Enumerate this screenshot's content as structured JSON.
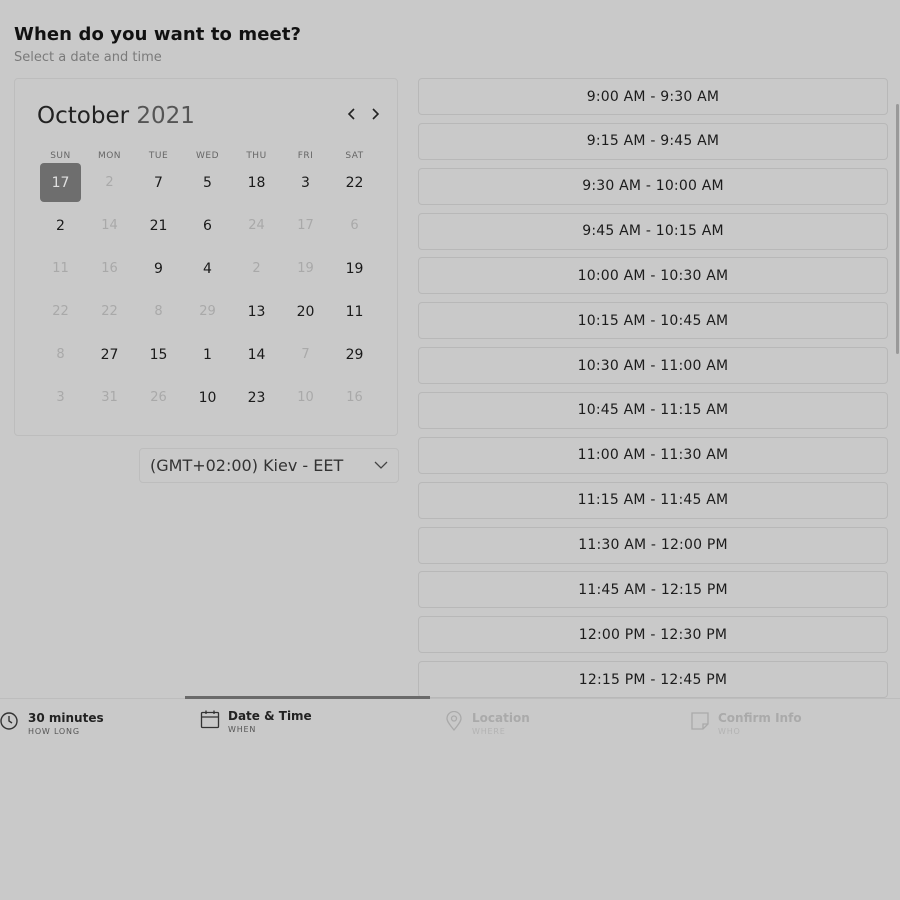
{
  "header": {
    "title": "When do you want to meet?",
    "subtitle": "Select a date and time"
  },
  "calendar": {
    "month": "October",
    "year": "2021",
    "weekdays": [
      "SUN",
      "MON",
      "TUE",
      "WED",
      "THU",
      "FRI",
      "SAT"
    ],
    "rows": [
      [
        {
          "v": "17",
          "s": "selected"
        },
        {
          "v": "2",
          "s": "disabled"
        },
        {
          "v": "7",
          "s": "available"
        },
        {
          "v": "5",
          "s": "available"
        },
        {
          "v": "18",
          "s": "available"
        },
        {
          "v": "3",
          "s": "available"
        },
        {
          "v": "22",
          "s": "available"
        }
      ],
      [
        {
          "v": "2",
          "s": "available"
        },
        {
          "v": "14",
          "s": "disabled"
        },
        {
          "v": "21",
          "s": "available"
        },
        {
          "v": "6",
          "s": "available"
        },
        {
          "v": "24",
          "s": "disabled"
        },
        {
          "v": "17",
          "s": "disabled"
        },
        {
          "v": "6",
          "s": "disabled"
        }
      ],
      [
        {
          "v": "11",
          "s": "disabled"
        },
        {
          "v": "16",
          "s": "disabled"
        },
        {
          "v": "9",
          "s": "available"
        },
        {
          "v": "4",
          "s": "available"
        },
        {
          "v": "2",
          "s": "disabled"
        },
        {
          "v": "19",
          "s": "disabled"
        },
        {
          "v": "19",
          "s": "available"
        }
      ],
      [
        {
          "v": "22",
          "s": "disabled"
        },
        {
          "v": "22",
          "s": "disabled"
        },
        {
          "v": "8",
          "s": "disabled"
        },
        {
          "v": "29",
          "s": "disabled"
        },
        {
          "v": "13",
          "s": "available"
        },
        {
          "v": "20",
          "s": "available"
        },
        {
          "v": "11",
          "s": "available"
        }
      ],
      [
        {
          "v": "8",
          "s": "disabled"
        },
        {
          "v": "27",
          "s": "available"
        },
        {
          "v": "15",
          "s": "available"
        },
        {
          "v": "1",
          "s": "available"
        },
        {
          "v": "14",
          "s": "available"
        },
        {
          "v": "7",
          "s": "disabled"
        },
        {
          "v": "29",
          "s": "available"
        }
      ],
      [
        {
          "v": "3",
          "s": "disabled"
        },
        {
          "v": "31",
          "s": "disabled"
        },
        {
          "v": "26",
          "s": "disabled"
        },
        {
          "v": "10",
          "s": "available"
        },
        {
          "v": "23",
          "s": "available"
        },
        {
          "v": "10",
          "s": "disabled"
        },
        {
          "v": "16",
          "s": "disabled"
        }
      ]
    ]
  },
  "timezone": {
    "value": "(GMT+02:00) Kiev - EET"
  },
  "slots": [
    "9:00 AM - 9:30 AM",
    "9:15 AM - 9:45 AM",
    "9:30 AM - 10:00 AM",
    "9:45 AM - 10:15 AM",
    "10:00 AM - 10:30 AM",
    "10:15 AM - 10:45 AM",
    "10:30 AM - 11:00 AM",
    "10:45 AM - 11:15 AM",
    "11:00 AM - 11:30 AM",
    "11:15 AM - 11:45 AM",
    "11:30 AM - 12:00 PM",
    "11:45 AM - 12:15 PM",
    "12:00 PM - 12:30 PM",
    "12:15 PM - 12:45 PM"
  ],
  "steps": [
    {
      "title": "30 minutes",
      "sub": "HOW LONG",
      "icon": "clock-icon",
      "state": "done"
    },
    {
      "title": "Date & Time",
      "sub": "WHEN",
      "icon": "calendar-icon",
      "state": "active"
    },
    {
      "title": "Location",
      "sub": "WHERE",
      "icon": "location-pin-icon",
      "state": "pending"
    },
    {
      "title": "Confirm Info",
      "sub": "WHO",
      "icon": "note-icon",
      "state": "pending"
    }
  ]
}
